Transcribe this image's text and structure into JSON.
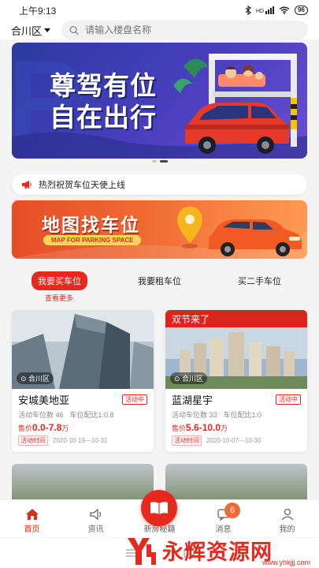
{
  "status_bar": {
    "time": "上午9:13",
    "signal_label": "HD",
    "battery": "96"
  },
  "header": {
    "district": "合川区",
    "search_placeholder": "请输入楼盘名称"
  },
  "banner": {
    "line1": "尊驾有位",
    "line2": "自在出行"
  },
  "notice": {
    "text": "热烈祝贺车位天使上线"
  },
  "map_banner": {
    "title": "地图找车位",
    "subtitle": "MAP FOR PARKING SPACE"
  },
  "category_tabs": [
    {
      "label": "我要买车位",
      "active": true
    },
    {
      "label": "我要租车位",
      "active": false
    },
    {
      "label": "买二手车位",
      "active": false
    }
  ],
  "see_more": "查看更多",
  "listings": [
    {
      "location": "合川区",
      "ribbon": "",
      "name": "安城美地亚",
      "status": "活动中",
      "spaces": "活动车位数 46",
      "ratio": "车位配比1:0.8",
      "price_prefix": "售价",
      "price": "0.0-7.8",
      "price_unit": "万",
      "time_label": "活动时间",
      "time": "2020-10-19—10-31"
    },
    {
      "location": "合川区",
      "ribbon": "双节来了",
      "name": "蓝湖星宇",
      "status": "活动中",
      "spaces": "活动车位数 33",
      "ratio": "车位配比1:0",
      "price_prefix": "售价",
      "price": "5.6-10.0",
      "price_unit": "万",
      "time_label": "活动时间",
      "time": "2020-10-07—10-30"
    }
  ],
  "tabbar": {
    "home": "首页",
    "news": "资讯",
    "center": "新房秘籍",
    "messages": "消息",
    "message_count": "6",
    "mine": "我的"
  },
  "watermark": {
    "cn": "永辉资源网",
    "url": "www.yhkjjj.com"
  },
  "colors": {
    "accent": "#e8271f",
    "banner_bg": "#3b3fb0",
    "map_banner_bg": "#f06a34"
  }
}
